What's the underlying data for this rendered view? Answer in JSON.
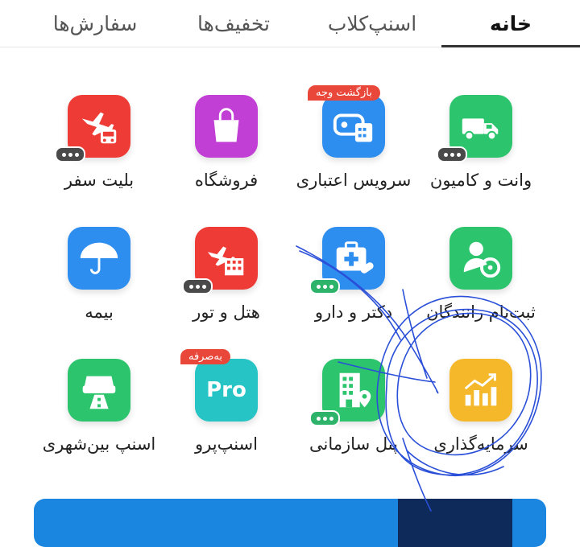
{
  "tabs": [
    {
      "label": "خانه",
      "active": true
    },
    {
      "label": "اسنپ‌کلاب",
      "active": false
    },
    {
      "label": "تخفیف‌ها",
      "active": false
    },
    {
      "label": "سفارش‌ها",
      "active": false
    }
  ],
  "items": [
    {
      "label": "وانت و کامیون",
      "icon": "truck-icon",
      "color": "#2cc46d"
    },
    {
      "label": "سرویس اعتباری",
      "icon": "wallet-icon",
      "color": "#2d8ef0",
      "badge": "بازگشت وجه"
    },
    {
      "label": "فروشگاه",
      "icon": "shopping-bag-icon",
      "color": "#c23fd6"
    },
    {
      "label": "بلیت سفر",
      "icon": "plane-bus-icon",
      "color": "#ef3b36"
    },
    {
      "label": "ثبت‌نام رانندگان",
      "icon": "driver-icon",
      "color": "#2cc46d"
    },
    {
      "label": "دکتر و دارو",
      "icon": "medical-kit-icon",
      "color": "#2d8ef0"
    },
    {
      "label": "هتل و تور",
      "icon": "hotel-plane-icon",
      "color": "#ef3b36"
    },
    {
      "label": "بیمه",
      "icon": "umbrella-icon",
      "color": "#2d8ef0"
    },
    {
      "label": "سرمایه‌گذاری",
      "icon": "chart-up-icon",
      "color": "#f5b82a"
    },
    {
      "label": "پنل سازمانی",
      "icon": "building-icon",
      "color": "#2cc46d"
    },
    {
      "label": "اسنپ‌پرو",
      "icon": "pro-icon",
      "color": "#26c4c4",
      "badge": "به‌صرفه",
      "pro_text": "Pro"
    },
    {
      "label": "اسنپ بین‌شهری",
      "icon": "car-road-icon",
      "color": "#2cc46d"
    }
  ]
}
